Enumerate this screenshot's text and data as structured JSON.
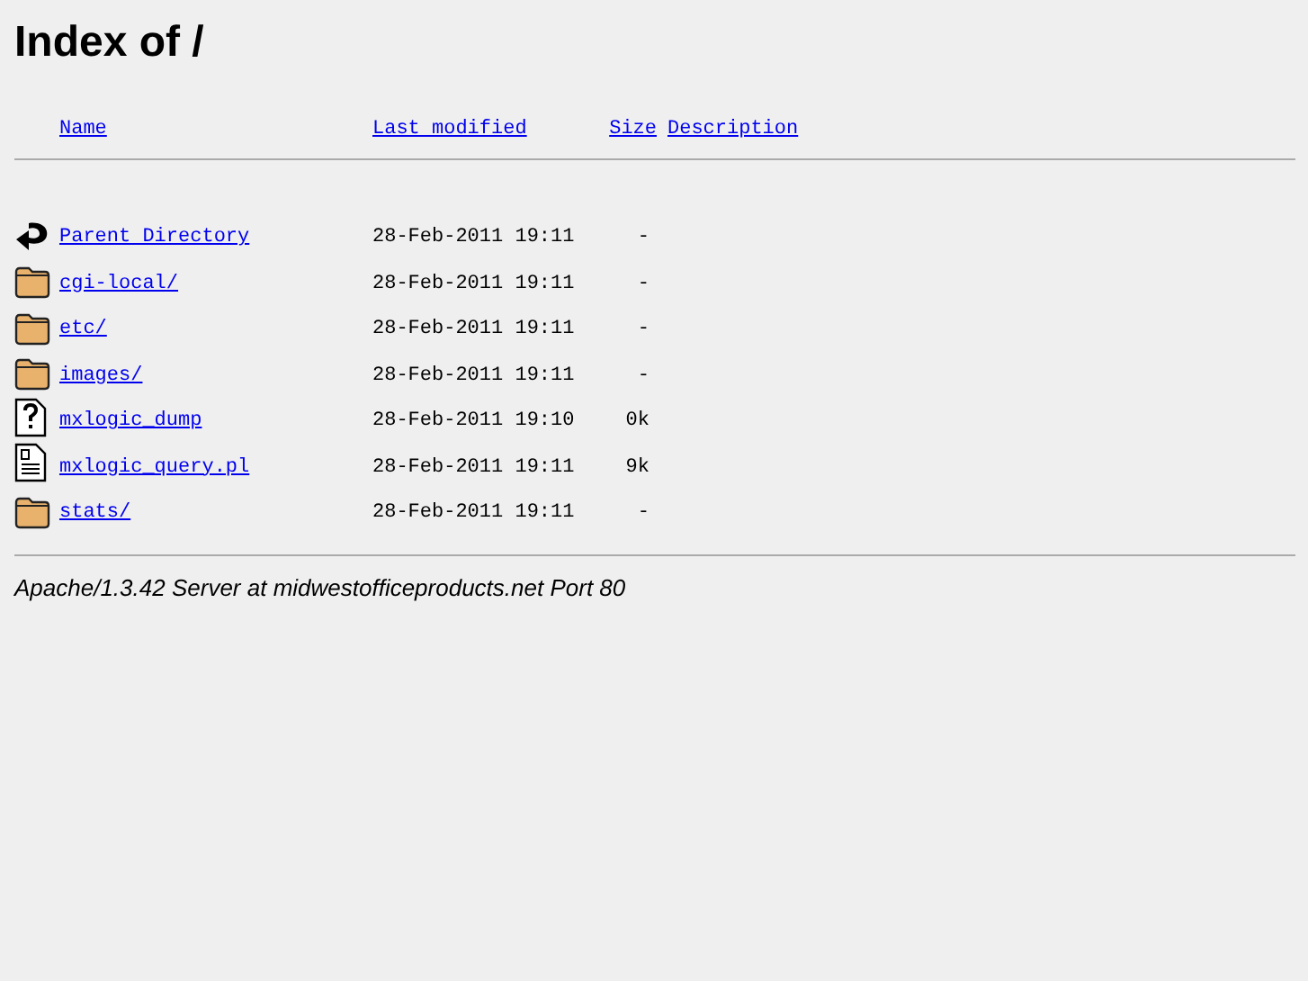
{
  "title": "Index of /",
  "columns": [
    "Name",
    "Last modified",
    "Size",
    "Description"
  ],
  "rows": [
    {
      "kind": "back",
      "name": "Parent Directory",
      "modified": "28-Feb-2011 19:11",
      "size": "-"
    },
    {
      "kind": "folder",
      "name": "cgi-local/",
      "modified": "28-Feb-2011 19:11",
      "size": "-"
    },
    {
      "kind": "folder",
      "name": "etc/",
      "modified": "28-Feb-2011 19:11",
      "size": "-"
    },
    {
      "kind": "folder",
      "name": "images/",
      "modified": "28-Feb-2011 19:11",
      "size": "-"
    },
    {
      "kind": "unknown",
      "name": "mxlogic_dump",
      "modified": "28-Feb-2011 19:10",
      "size": "0k"
    },
    {
      "kind": "text",
      "name": "mxlogic_query.pl",
      "modified": "28-Feb-2011 19:11",
      "size": "9k"
    },
    {
      "kind": "folder",
      "name": "stats/",
      "modified": "28-Feb-2011 19:11",
      "size": "-"
    }
  ],
  "footer": "Apache/1.3.42 Server at midwestofficeproducts.net Port 80"
}
